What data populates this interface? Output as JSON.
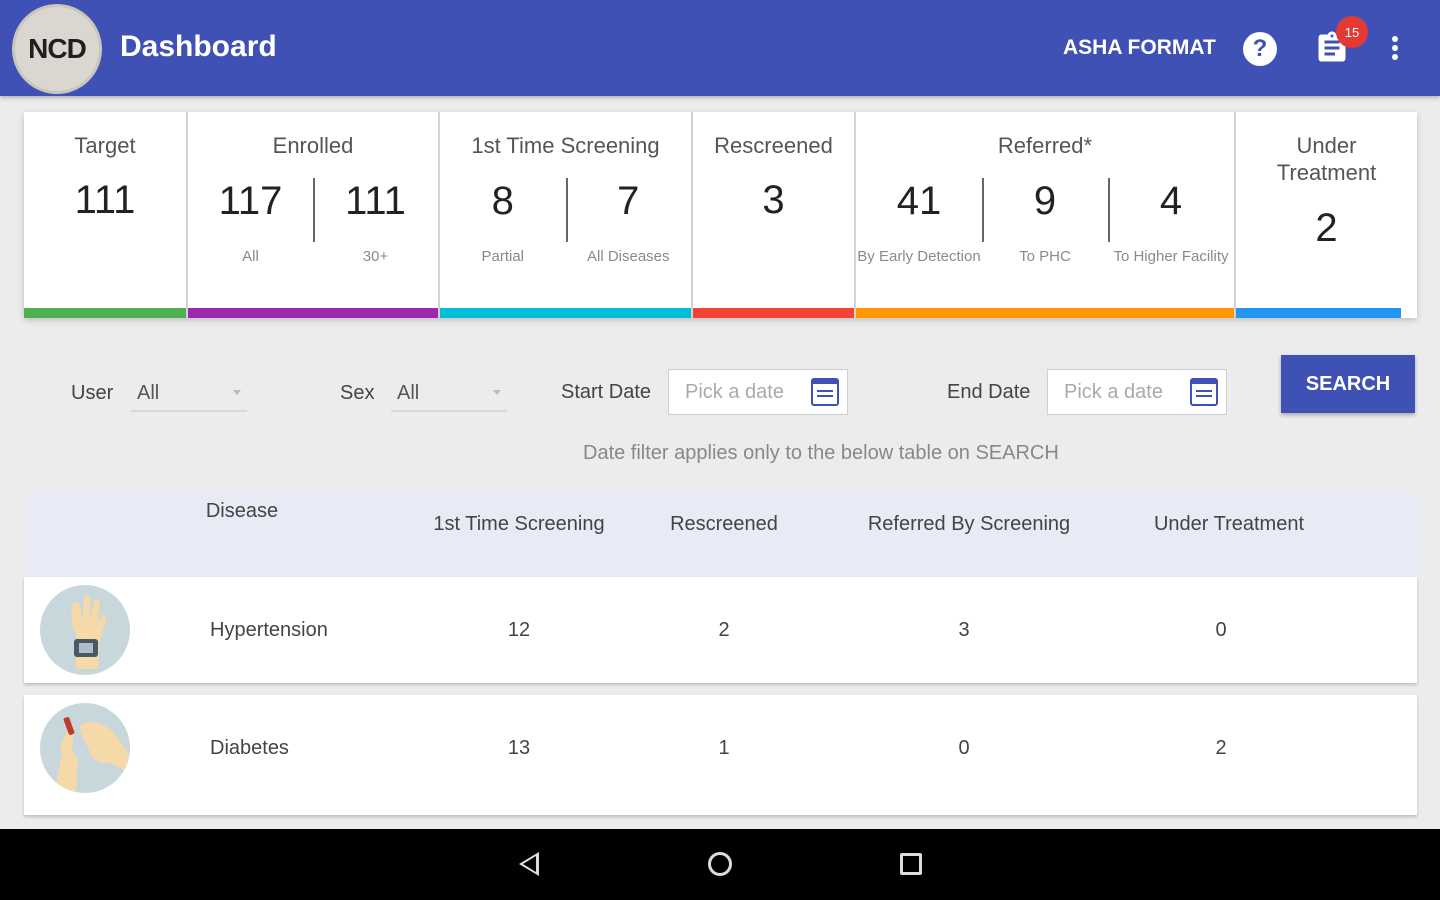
{
  "app_bar": {
    "logo_text": "NCD",
    "title": "Dashboard",
    "format_label": "ASHA FORMAT",
    "help_label": "?",
    "notification_count": "15",
    "icons": [
      "help-icon",
      "clipboard-icon",
      "more-vert-icon"
    ],
    "color": "#3f51b5"
  },
  "summary": {
    "target": {
      "title": "Target",
      "value": "111",
      "color": "#4caf50"
    },
    "enrolled": {
      "title": "Enrolled",
      "items": [
        {
          "value": "117",
          "caption": "All"
        },
        {
          "value": "111",
          "caption": "30+"
        }
      ],
      "color": "#9c27b0"
    },
    "first_screening": {
      "title": "1st Time Screening",
      "items": [
        {
          "value": "8",
          "caption": "Partial"
        },
        {
          "value": "7",
          "caption": "All Diseases"
        }
      ],
      "color": "#00bcd4"
    },
    "rescreened": {
      "title": "Rescreened",
      "value": "3",
      "color": "#f44336"
    },
    "referred": {
      "title": "Referred*",
      "items": [
        {
          "value": "41",
          "caption": "By Early Detection"
        },
        {
          "value": "9",
          "caption": "To PHC"
        },
        {
          "value": "4",
          "caption": "To Higher Facility"
        }
      ],
      "color": "#ff9800"
    },
    "under_treatment": {
      "title": "Under Treatment",
      "value": "2",
      "color": "#2196f3"
    }
  },
  "filters": {
    "user_label": "User",
    "user_value": "All",
    "sex_label": "Sex",
    "sex_value": "All",
    "start_date_label": "Start Date",
    "start_date_placeholder": "Pick a date",
    "end_date_label": "End Date",
    "end_date_placeholder": "Pick a date",
    "search_label": "SEARCH",
    "hint": "Date filter applies only to the below table on SEARCH"
  },
  "table": {
    "headers": [
      "Disease",
      "1st Time Screening",
      "Rescreened",
      "Referred By Screening",
      "Under Treatment"
    ],
    "rows": [
      {
        "disease": "Hypertension",
        "first_screening": "12",
        "rescreened": "2",
        "referred": "3",
        "under_treatment": "0",
        "icon": "blood-pressure-wrist-icon"
      },
      {
        "disease": "Diabetes",
        "first_screening": "13",
        "rescreened": "1",
        "referred": "0",
        "under_treatment": "2",
        "icon": "finger-prick-icon"
      }
    ]
  },
  "nav": {
    "icons": [
      "back-icon",
      "home-icon",
      "recents-icon"
    ]
  }
}
